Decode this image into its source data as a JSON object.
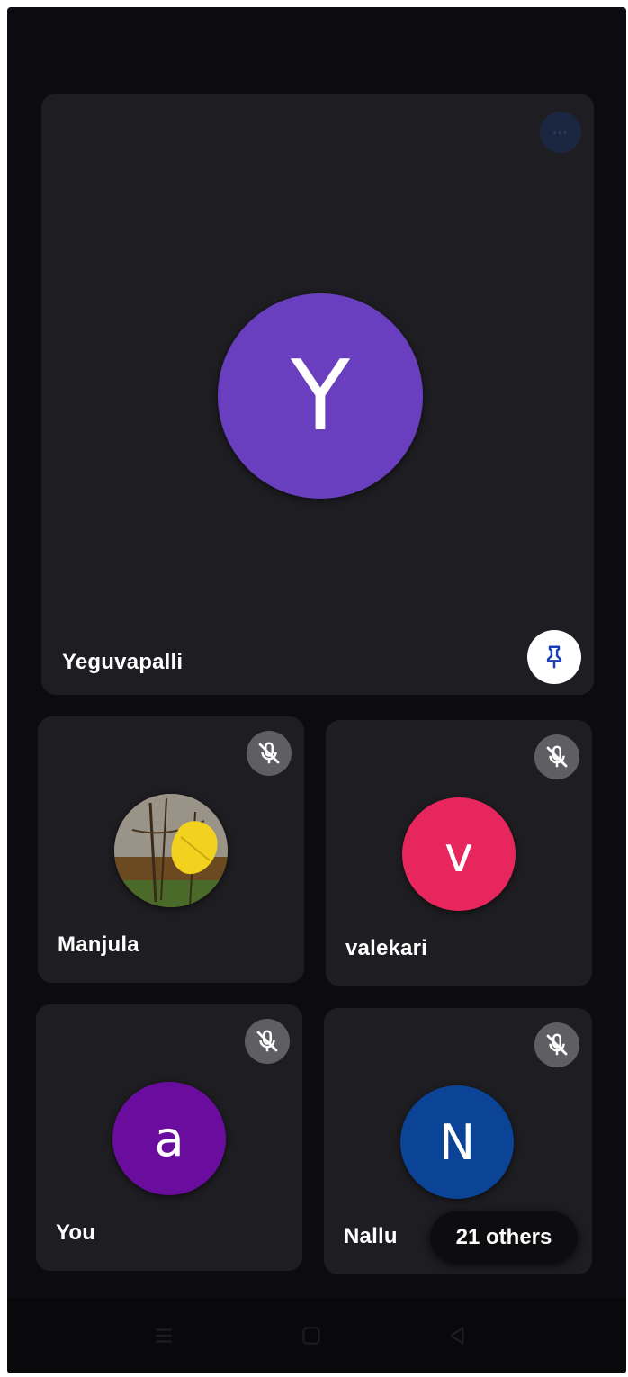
{
  "colors": {
    "screen_bg": "#0c0c10",
    "tile_bg": "#1e1e22",
    "pin_icon": "#1a3fb5",
    "mic_off_bg": "#5f5f63"
  },
  "main_participant": {
    "initial": "Y",
    "name": "Yeguvapalli",
    "avatar_color": "#6a3fbf",
    "more_icon": "more-options-icon",
    "more_glyph": "···",
    "pin_icon": "pin-icon"
  },
  "participants": [
    {
      "name": "Manjula",
      "avatar_type": "photo",
      "avatar_desc": "yellow-leaf-photo",
      "mic_icon": "mic-off-icon"
    },
    {
      "name": "valekari",
      "initial": "v",
      "avatar_color": "#e8265e",
      "mic_icon": "mic-off-icon"
    },
    {
      "name": "You",
      "initial": "a",
      "avatar_color": "#6a0d9e",
      "mic_icon": "mic-off-icon"
    },
    {
      "name": "Nallu",
      "initial": "N",
      "avatar_color": "#0b4396",
      "mic_icon": "mic-off-icon"
    }
  ],
  "others_pill": {
    "label": "21 others"
  },
  "navbar": {
    "items": [
      "menu-icon",
      "home-icon",
      "back-icon"
    ]
  }
}
